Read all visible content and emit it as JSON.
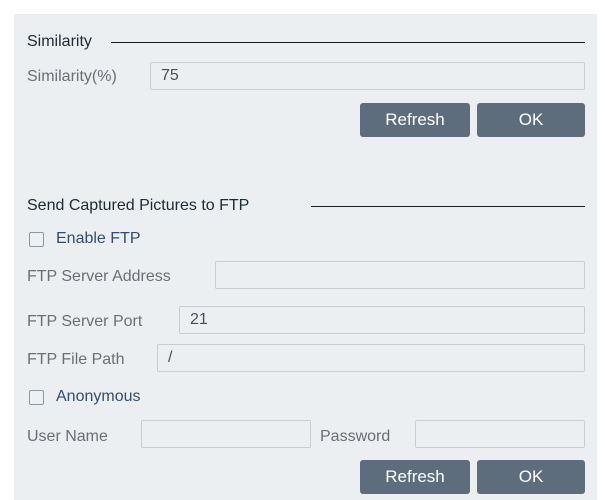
{
  "similarity": {
    "section_title": "Similarity",
    "field_label": "Similarity(%)",
    "field_value": "75",
    "refresh_label": "Refresh",
    "ok_label": "OK"
  },
  "ftp": {
    "section_title": "Send Captured Pictures to FTP",
    "enable_label": "Enable FTP",
    "enable_checked": false,
    "server_address_label": "FTP Server Address",
    "server_address_value": "",
    "server_port_label": "FTP Server Port",
    "server_port_value": "21",
    "file_path_label": "FTP File Path",
    "file_path_value": "/",
    "anonymous_label": "Anonymous",
    "anonymous_checked": false,
    "username_label": "User Name",
    "username_value": "",
    "password_label": "Password",
    "password_value": "",
    "refresh_label": "Refresh",
    "ok_label": "OK"
  },
  "colors": {
    "panel_background": "#eceff1",
    "button_background": "#5e6d7c",
    "checkbox_label": "#2f4e6f",
    "field_label": "#6a6f74"
  }
}
